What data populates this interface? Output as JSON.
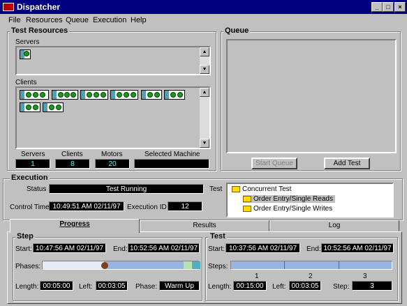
{
  "window": {
    "title": "Dispatcher",
    "btn_min": "_",
    "btn_max": "□",
    "btn_close": "×"
  },
  "menu": [
    "File",
    "Resources",
    "Queue",
    "Execution",
    "Help"
  ],
  "resources": {
    "title": "Test Resources",
    "servers_label": "Servers",
    "clients_label": "Clients",
    "stats": {
      "servers_label": "Servers",
      "servers_value": "1",
      "clients_label": "Clients",
      "clients_value": "8",
      "motors_label": "Motors",
      "motors_value": "20",
      "machine_label": "Selected Machine",
      "machine_value": ""
    }
  },
  "queue": {
    "title": "Queue",
    "start_label": "Start Queue",
    "add_label": "Add Test"
  },
  "execution": {
    "title": "Execution",
    "status_label": "Status",
    "status_value": "Test Running",
    "control_label": "Control Time",
    "control_value": "10:49:51 AM 02/11/97",
    "exec_id_label": "Execution ID",
    "exec_id_value": "12",
    "test_label": "Test",
    "tree": {
      "root": "Concurrent Test",
      "items": [
        "Order Entry/Single Reads",
        "Order Entry/Single Writes"
      ]
    }
  },
  "tabs": [
    "Progress",
    "Results",
    "Log"
  ],
  "step": {
    "title": "Step",
    "start_label": "Start:",
    "start_value": "10:47:56 AM 02/11/97",
    "end_label": "End:",
    "end_value": "10:52:56 AM 02/11/97",
    "phases_label": "Phases:",
    "length_label": "Length:",
    "length_value": "00:05:00",
    "left_label": "Left:",
    "left_value": "00:03:05",
    "phase_label": "Phase:",
    "phase_value": "Warm Up"
  },
  "test": {
    "title": "Test",
    "start_label": "Start:",
    "start_value": "10:37:56 AM 02/11/97",
    "end_label": "End:",
    "end_value": "10:52:56 AM 02/11/97",
    "steps_label": "Steps:",
    "step_ticks": [
      "1",
      "2",
      "3"
    ],
    "length_label": "Length:",
    "length_value": "00:15:00",
    "left_label": "Left:",
    "left_value": "00:03:05",
    "step_label": "Step:",
    "step_value": "3"
  }
}
